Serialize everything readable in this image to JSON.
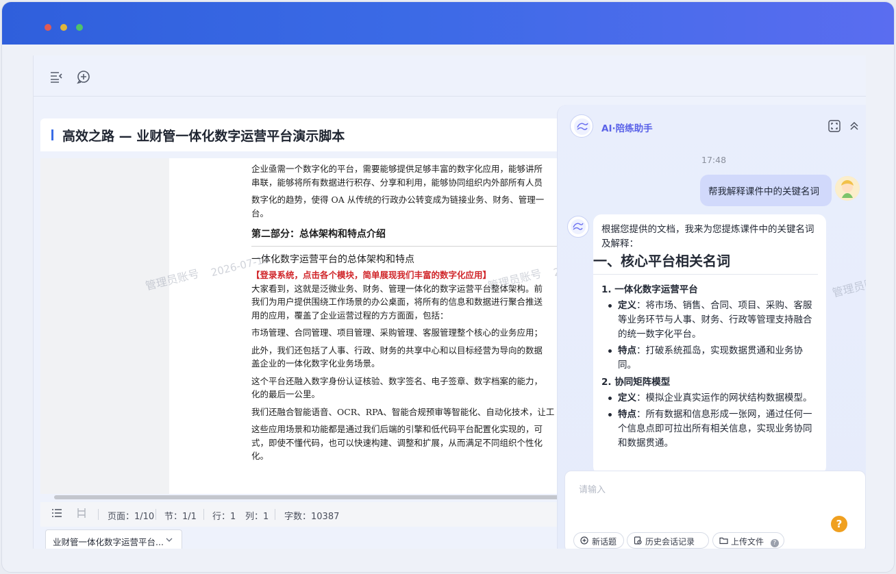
{
  "window": {
    "controls": [
      "close",
      "minimize",
      "maximize"
    ]
  },
  "toolbar": {
    "icons": [
      "outline-toggle-icon",
      "comment-icon"
    ]
  },
  "document": {
    "title": "高效之路 — 业财管一体化数字运营平台演示脚本",
    "paragraphs": [
      {
        "lines": [
          "企业亟需一个数字化的平台，需要能够提供足够丰富的数字化应用，能够讲所",
          "串联，能够将所有数据进行积存、分享和利用，能够协同组织内外部所有人员"
        ]
      },
      {
        "lines": [
          "数字化的趋势，使得 OA 从传统的行政办公转变成为链接业务、财务、管理一",
          "台。"
        ]
      }
    ],
    "section_heading": "第二部分：总体架构和特点介绍",
    "sub_heading": "一体化数字运营平台的总体架构和特点",
    "red_instruction": "【登录系统，点击各个模块，简单展现我们丰富的数字化应用】",
    "body": [
      {
        "lines": [
          "大家看到，这就是泛微业务、财务、管理一体化的数字运营平台整体架构。前",
          "我们为用户提供围绕工作场景的办公桌面，将所有的信息和数据进行聚合推送",
          "用的应用，覆盖了企业运营过程的方方面面，包括："
        ]
      },
      {
        "lines": [
          "市场管理、合同管理、项目管理、采购管理、客服管理整个核心的业务应用；"
        ]
      },
      {
        "lines": [
          "此外，我们还包括了人事、行政、财务的共享中心和以目标经营为导向的数据",
          "盖企业的一体化数字化业务场景。"
        ]
      },
      {
        "lines": [
          "这个平台还融入数字身份认证核验、数字签名、电子签章、数字档案的能力，",
          "化的最后一公里。"
        ]
      },
      {
        "lines": [
          "我们还融合智能语音、OCR、RPA、智能合规预审等智能化、自动化技术，让工"
        ]
      },
      {
        "lines": [
          "这些应用场景和功能都是通过我们后端的引擎和低代码平台配置化实现的，可",
          "式，即使不懂代码，也可以快速构建、调整和扩展，从而满足不同组织个性化",
          "化。"
        ]
      }
    ],
    "watermarks": [
      "管理员账号",
      "2026-07-13",
      "管理员账号",
      "2026-07-13",
      "管理员账"
    ]
  },
  "statusbar": {
    "page": "页面：1/10",
    "section": "节：1/1",
    "row": "行：1",
    "col": "列：1",
    "words": "字数：10387"
  },
  "file_tab": {
    "label": "业财管一体化数字运营平台...",
    "icon": "chevron-down-icon"
  },
  "chat": {
    "title": "AI·陪练助手",
    "time": "17:48",
    "user_message": "帮我解释课件中的关键名词",
    "bot": {
      "intro": "根据您提供的文档，我来为您提炼课件中的关键名词及解释：",
      "heading": "一、核心平台相关名词",
      "items": [
        {
          "title": "1. 一体化数字运营平台",
          "points": [
            {
              "label": "定义",
              "text": "：将市场、销售、合同、项目、采购、客服等业务环节与人事、财务、行政等管理支持融合的统一数字化平台。"
            },
            {
              "label": "特点",
              "text": "：打破系统孤岛，实现数据贯通和业务协同。"
            }
          ]
        },
        {
          "title": "2. 协同矩阵模型",
          "points": [
            {
              "label": "定义",
              "text": "：模拟企业真实运作的网状结构数据模型。"
            },
            {
              "label": "特点",
              "text": "：所有数据和信息形成一张网，通过任何一个信息点即可拉出所有相关信息，实现业务协同和数据贯通。"
            }
          ]
        }
      ]
    },
    "input_placeholder": "请输入",
    "actions": {
      "new_topic": "新话题",
      "history": "历史会话记录",
      "upload": "上传文件"
    },
    "help": "?"
  },
  "colors": {
    "titlebar": "#3b6ae6",
    "accent": "#5a62e8",
    "red": "#d0262a",
    "help": "#f0a020"
  }
}
